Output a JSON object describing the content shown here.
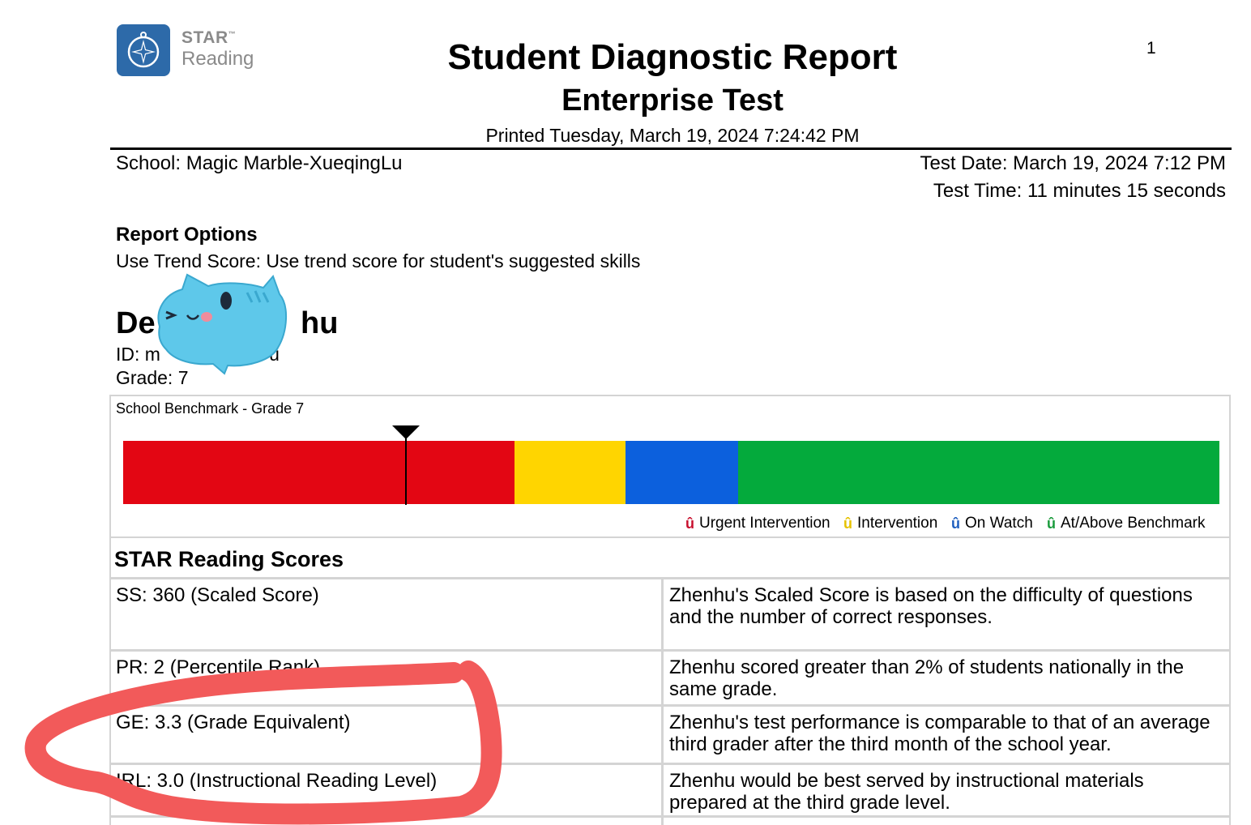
{
  "logo": {
    "star": "STAR",
    "tm": "™",
    "reading": "Reading"
  },
  "header": {
    "title": "Student Diagnostic Report",
    "subtitle": "Enterprise Test",
    "printed": "Printed Tuesday, March 19, 2024 7:24:42 PM",
    "page_number": "1"
  },
  "meta": {
    "school": "School: Magic Marble-XueqingLu",
    "test_date": "Test Date: March 19, 2024 7:12 PM",
    "test_time": "Test Time: 11 minutes 15 seconds"
  },
  "report_options": {
    "heading": "Report Options",
    "trend": "Use Trend Score: Use trend score for student's suggested skills"
  },
  "student": {
    "name": "De                 hu",
    "id": "ID: m                     u",
    "grade": "Grade: 7"
  },
  "benchmark": {
    "title": "School Benchmark - Grade 7",
    "marker_fraction": 0.258,
    "segments": [
      {
        "name": "Urgent Intervention",
        "color": "#e30613",
        "fraction": 0.357
      },
      {
        "name": "Intervention",
        "color": "#ffd500",
        "fraction": 0.101
      },
      {
        "name": "On Watch",
        "color": "#0c60dd",
        "fraction": 0.103
      },
      {
        "name": "At/Above Benchmark",
        "color": "#04aa3c",
        "fraction": 0.439
      }
    ],
    "legend": [
      {
        "label": "Urgent Intervention",
        "color": "#c8102e"
      },
      {
        "label": "Intervention",
        "color": "#e6c200"
      },
      {
        "label": "On Watch",
        "color": "#1f5fbf"
      },
      {
        "label": "At/Above Benchmark",
        "color": "#1a9b3c"
      }
    ]
  },
  "scores": {
    "heading": "STAR Reading Scores",
    "rows": [
      {
        "score": "SS: 360 (Scaled Score)",
        "desc": "Zhenhu's Scaled Score is based on the difficulty of questions and the number of correct responses."
      },
      {
        "score": "PR: 2 (Percentile Rank)",
        "desc": "Zhenhu scored greater than 2% of students nationally in the same grade."
      },
      {
        "score": "GE: 3.3 (Grade Equivalent)",
        "desc": "Zhenhu's test performance is comparable to that of an average third grader after the third month of the school year."
      },
      {
        "score": "IRL: 3.0 (Instructional Reading Level)",
        "desc": "Zhenhu would be best served by instructional materials prepared at the third grade level."
      }
    ]
  },
  "annotation_color": "#f25a5a",
  "sticker_color": "#5ec8ea"
}
